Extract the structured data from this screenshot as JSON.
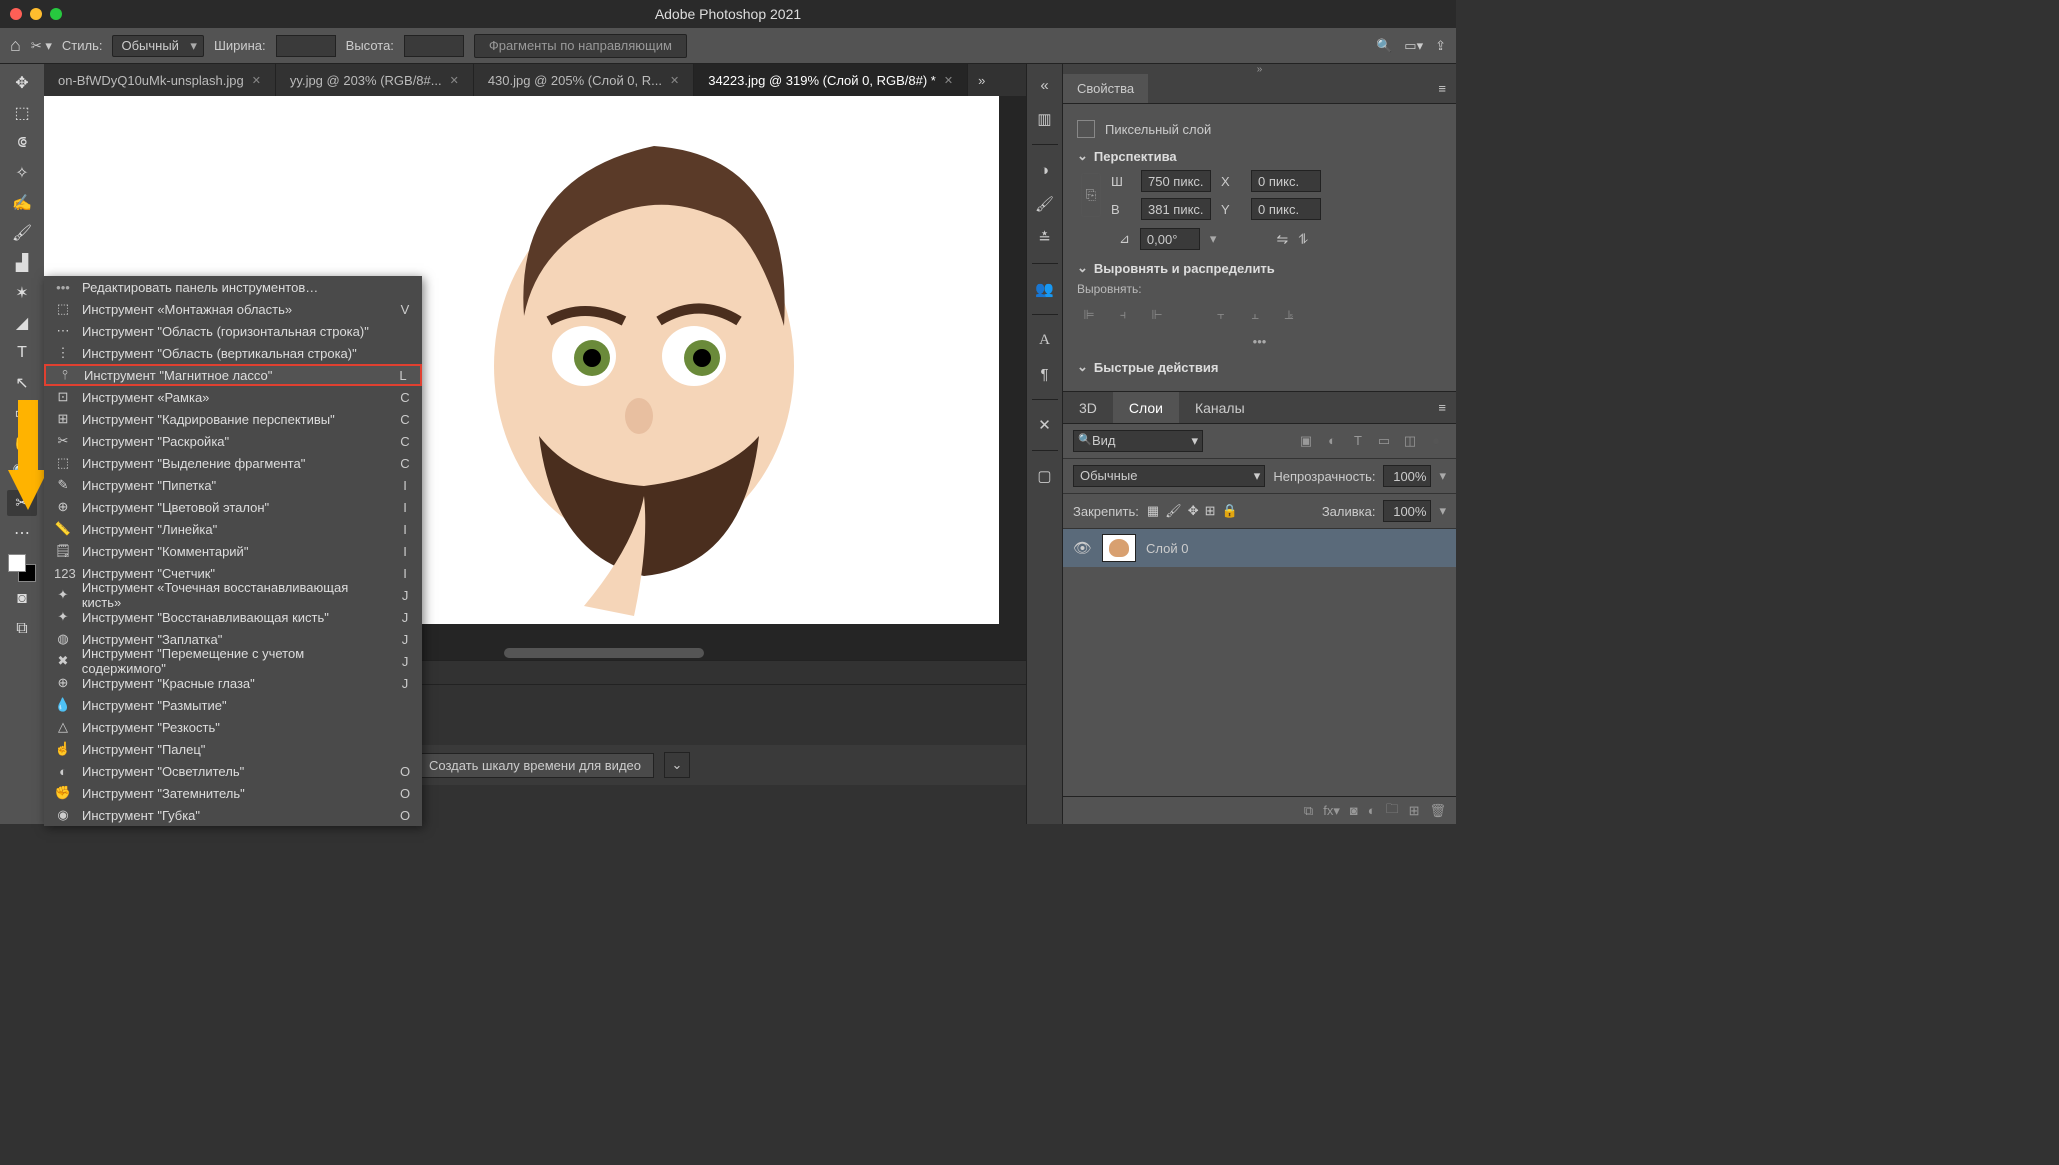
{
  "title": "Adobe Photoshop 2021",
  "options": {
    "style_label": "Стиль:",
    "style_value": "Обычный",
    "width_label": "Ширина:",
    "height_label": "Высота:",
    "guides_btn": "Фрагменты по направляющим"
  },
  "tabs": [
    {
      "label": "on-BfWDyQ10uMk-unsplash.jpg",
      "active": false
    },
    {
      "label": "yy.jpg @ 203% (RGB/8#...",
      "active": false
    },
    {
      "label": "430.jpg @ 205% (Слой 0, R...",
      "active": false
    },
    {
      "label": "34223.jpg @ 319% (Слой 0, RGB/8#) *",
      "active": true
    }
  ],
  "flyout": {
    "edit_label": "Редактировать панель инструментов…",
    "items": [
      {
        "label": "Инструмент «Монтажная область»",
        "key": "V",
        "icon": "⬚"
      },
      {
        "label": "Инструмент \"Область (горизонтальная строка)\"",
        "key": "",
        "icon": "⋯"
      },
      {
        "label": "Инструмент \"Область (вертикальная строка)\"",
        "key": "",
        "icon": "⋮"
      },
      {
        "label": "Инструмент \"Магнитное лассо\"",
        "key": "L",
        "icon": "⫯",
        "hl": true
      },
      {
        "label": "Инструмент «Рамка»",
        "key": "C",
        "icon": "⊡"
      },
      {
        "label": "Инструмент \"Кадрирование перспективы\"",
        "key": "C",
        "icon": "⊞"
      },
      {
        "label": "Инструмент \"Раскройка\"",
        "key": "C",
        "icon": "✂"
      },
      {
        "label": "Инструмент \"Выделение фрагмента\"",
        "key": "C",
        "icon": "⬚"
      },
      {
        "label": "Инструмент \"Пипетка\"",
        "key": "I",
        "icon": "✎"
      },
      {
        "label": "Инструмент \"Цветовой эталон\"",
        "key": "I",
        "icon": "⊕"
      },
      {
        "label": "Инструмент \"Линейка\"",
        "key": "I",
        "icon": "📏"
      },
      {
        "label": "Инструмент \"Комментарий\"",
        "key": "I",
        "icon": "🗒"
      },
      {
        "label": "Инструмент \"Счетчик\"",
        "key": "I",
        "icon": "123"
      },
      {
        "label": "Инструмент «Точечная восстанавливающая кисть»",
        "key": "J",
        "icon": "✦"
      },
      {
        "label": "Инструмент \"Восстанавливающая кисть\"",
        "key": "J",
        "icon": "✦"
      },
      {
        "label": "Инструмент \"Заплатка\"",
        "key": "J",
        "icon": "◍"
      },
      {
        "label": "Инструмент \"Перемещение с учетом содержимого\"",
        "key": "J",
        "icon": "✖"
      },
      {
        "label": "Инструмент \"Красные глаза\"",
        "key": "J",
        "icon": "⊕"
      },
      {
        "label": "Инструмент \"Размытие\"",
        "key": "",
        "icon": "💧"
      },
      {
        "label": "Инструмент \"Резкость\"",
        "key": "",
        "icon": "△"
      },
      {
        "label": "Инструмент \"Палец\"",
        "key": "",
        "icon": "☝"
      },
      {
        "label": "Инструмент \"Осветлитель\"",
        "key": "O",
        "icon": "◐"
      },
      {
        "label": "Инструмент \"Затемнитель\"",
        "key": "O",
        "icon": "✊"
      },
      {
        "label": "Инструмент \"Губка\"",
        "key": "O",
        "icon": "◉"
      }
    ]
  },
  "properties": {
    "tab": "Свойства",
    "type_label": "Пиксельный слой",
    "section1": "Перспектива",
    "w_label": "Ш",
    "w_val": "750 пикс.",
    "h_label": "В",
    "h_val": "381 пикс.",
    "x_label": "X",
    "x_val": "0 пикс.",
    "y_label": "Y",
    "y_val": "0 пикс.",
    "angle_val": "0,00°",
    "section2": "Выровнять и распределить",
    "align_label": "Выровнять:",
    "section3": "Быстрые действия"
  },
  "layers": {
    "tabs": [
      "3D",
      "Слои",
      "Каналы"
    ],
    "filter_val": "Вид",
    "blend_val": "Обычные",
    "opacity_label": "Непрозрачность:",
    "opacity_val": "100%",
    "lock_label": "Закрепить:",
    "fill_label": "Заливка:",
    "fill_val": "100%",
    "layer0": "Слой 0"
  },
  "timeline": {
    "btn": "Создать шкалу времени для видео"
  }
}
